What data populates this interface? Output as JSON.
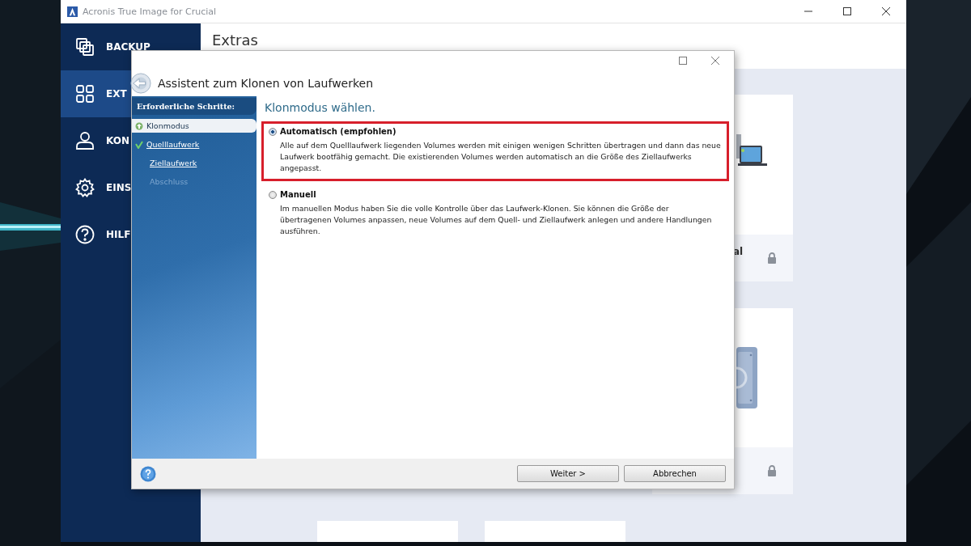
{
  "app": {
    "title": "Acronis True Image for Crucial"
  },
  "sidebar": {
    "items": [
      {
        "label": "BACKUP",
        "selected": false
      },
      {
        "label": "EXT",
        "selected": true
      },
      {
        "label": "KON",
        "selected": false
      },
      {
        "label": "EINS",
        "selected": false
      },
      {
        "label": "HILF",
        "selected": false
      }
    ]
  },
  "main": {
    "title": "Extras",
    "cards": [
      {
        "caption": "al",
        "locked": true
      },
      {
        "locked": true
      }
    ]
  },
  "dialog": {
    "title": "Assistent zum Klonen von Laufwerken",
    "steps_header": "Erforderliche Schritte:",
    "steps": [
      {
        "label": "Klonmodus",
        "kind": "current"
      },
      {
        "label": "Quelllaufwerk",
        "kind": "done"
      },
      {
        "label": "Ziellaufwerk",
        "kind": "pending"
      },
      {
        "label": "Abschluss",
        "kind": "disabled"
      }
    ],
    "heading": "Klonmodus wählen.",
    "options": [
      {
        "label": "Automatisch (empfohlen)",
        "description": "Alle auf dem Quelllaufwerk liegenden Volumes werden mit einigen wenigen Schritten übertragen und dann das neue Laufwerk bootfähig gemacht. Die existierenden Volumes werden automatisch an die Größe des Ziellaufwerks angepasst.",
        "selected": true,
        "highlighted": true
      },
      {
        "label": "Manuell",
        "description": "Im manuellen Modus haben Sie die volle Kontrolle über das Laufwerk-Klonen. Sie können die Größe der übertragenen Volumes anpassen, neue Volumes auf dem Quell- und Ziellaufwerk anlegen und andere Handlungen ausführen.",
        "selected": false,
        "highlighted": false
      }
    ],
    "buttons": [
      {
        "label": "Weiter >"
      },
      {
        "label": "Abbrechen"
      }
    ]
  }
}
